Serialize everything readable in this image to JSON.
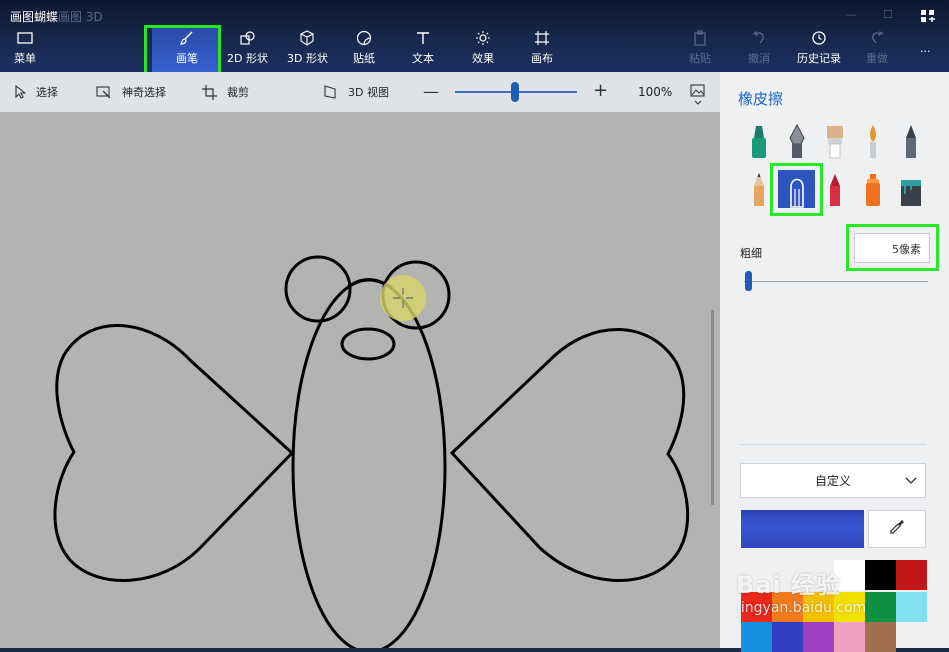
{
  "window": {
    "title": "画图蝴蝶",
    "title_ghost": "画图 3D"
  },
  "toolbar": {
    "menu_label": "菜单",
    "tools": [
      {
        "name": "brushes",
        "label": "画笔",
        "icon": "brush-icon",
        "selected": true
      },
      {
        "name": "2d-shapes",
        "label": "2D 形状",
        "icon": "2d-shapes-icon"
      },
      {
        "name": "3d-shapes",
        "label": "3D 形状",
        "icon": "3d-cube-icon"
      },
      {
        "name": "stickers",
        "label": "贴纸",
        "icon": "sticker-icon"
      },
      {
        "name": "text",
        "label": "文本",
        "icon": "text-icon"
      },
      {
        "name": "effects",
        "label": "效果",
        "icon": "sun-icon"
      },
      {
        "name": "canvas",
        "label": "画布",
        "icon": "canvas-icon"
      }
    ],
    "paste_label": "粘贴",
    "undo_label": "撤消",
    "history_label": "历史记录",
    "redo_label": "重做",
    "more_label": "..."
  },
  "subbar": {
    "select_label": "选择",
    "magic_select_label": "神奇选择",
    "crop_label": "裁剪",
    "view3d_label": "3D 视图",
    "zoom_minus": "—",
    "zoom_plus": "+",
    "zoom_value": "100%",
    "zoom_fraction": 0.49
  },
  "panel": {
    "title": "橡皮擦",
    "brushes": [
      {
        "name": "marker",
        "icon": "marker-icon",
        "color": "#1a9a7a"
      },
      {
        "name": "calligraphy-pen",
        "icon": "calligraphy-pen-icon",
        "color": "#6b6f78"
      },
      {
        "name": "oil-brush",
        "icon": "oil-brush-icon",
        "color": "#d9b48a"
      },
      {
        "name": "watercolor",
        "icon": "watercolor-icon",
        "color": "#e8962b"
      },
      {
        "name": "pixel-pen",
        "icon": "pixel-pen-icon",
        "color": "#606878"
      },
      {
        "name": "pencil",
        "icon": "pencil-icon",
        "color": "#e6a560"
      },
      {
        "name": "eraser",
        "icon": "eraser-icon",
        "color": "#ffffff",
        "selected": true
      },
      {
        "name": "crayon",
        "icon": "crayon-icon",
        "color": "#d83040"
      },
      {
        "name": "spray-can",
        "icon": "spray-can-icon",
        "color": "#f07020"
      },
      {
        "name": "fill-bucket",
        "icon": "fill-bucket-icon",
        "color": "#2aa0a0"
      }
    ],
    "thickness_label": "粗细",
    "thickness_value": "5像素",
    "thickness_fraction": 0.02,
    "color_mode": "自定义",
    "current_color": "#3147be",
    "swatches": [
      "#ffffff",
      "#000000",
      "#c01818",
      "#e8281c",
      "#f07a1c",
      "#f4c000",
      "#f0e000",
      "#109040",
      "#80e0f0",
      "#1890e0",
      "#3040c0",
      "#a040c0",
      "#f0a0c0",
      "#a07050"
    ]
  },
  "watermark": {
    "brand": "Bai 经验",
    "url": "jingyan.baidu.com"
  }
}
